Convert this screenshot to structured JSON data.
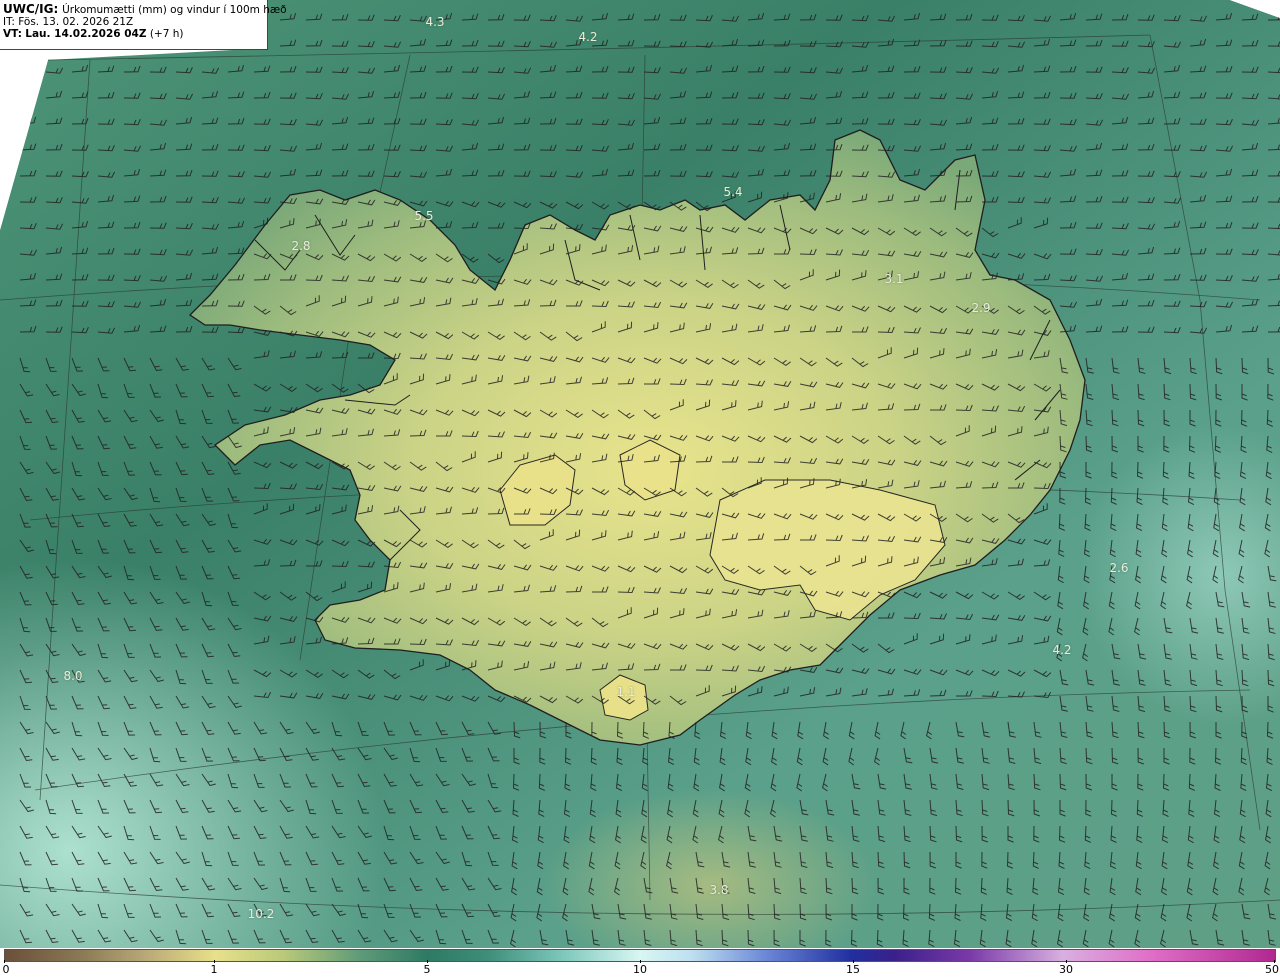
{
  "header": {
    "product": "UWC/IG:",
    "description": "Úrkomumætti (mm) og vindur í 100m hæð",
    "init_time": "IT: Fös. 13. 02. 2026 21Z",
    "valid_prefix": "VT:",
    "valid_time": "Lau. 14.02.2026 04Z",
    "lead": "(+7 h)"
  },
  "value_labels": [
    "4.3",
    "4.2",
    "5.5",
    "2.8",
    "5.4",
    "3.1",
    "2.9",
    "2.6",
    "4.2",
    "8.0",
    "3.8",
    "10.2",
    "1.1"
  ],
  "colorbar": {
    "ticks": [
      "0",
      "1",
      "5",
      "10",
      "15",
      "30",
      "50"
    ],
    "stops": [
      0,
      1,
      5,
      10,
      15,
      30,
      50
    ]
  },
  "colors": {
    "land_low": "#e6e08a",
    "sea_mid": "#3f8a6e",
    "sea_deep": "#2e7360",
    "sea_light": "#88c7b6",
    "coastline": "#222222",
    "barb": "#222222"
  }
}
